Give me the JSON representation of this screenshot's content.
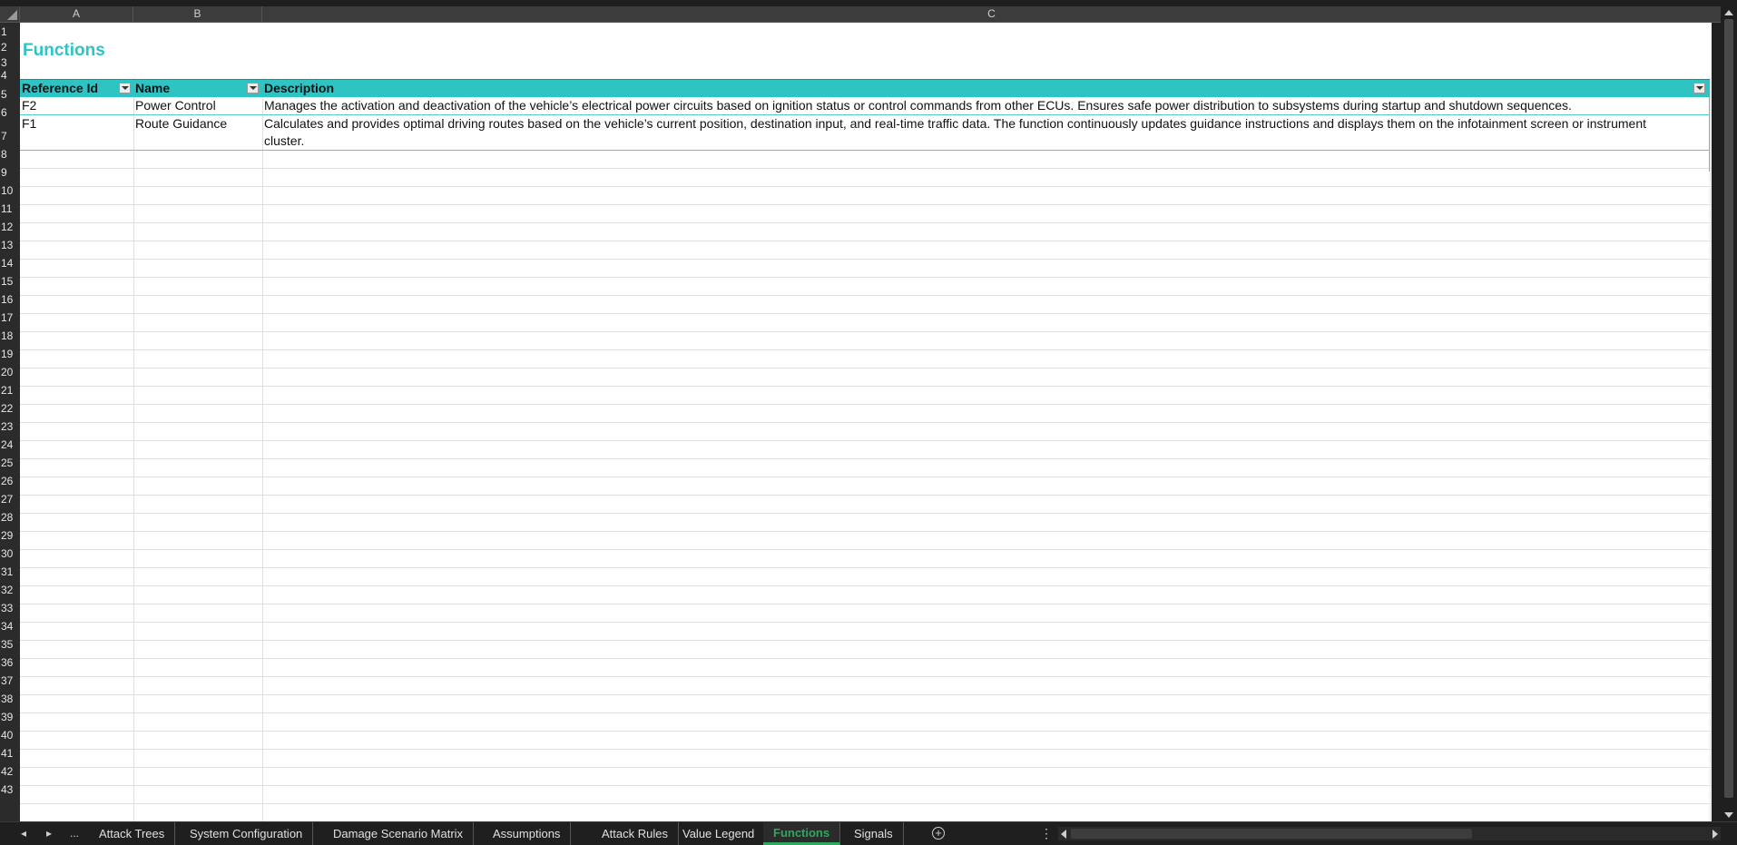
{
  "sheet": {
    "columns": [
      "A",
      "B",
      "C"
    ],
    "rows": [
      "1",
      "2",
      "3",
      "4",
      "5",
      "6",
      "7",
      "8",
      "9",
      "10",
      "11",
      "12",
      "13",
      "14",
      "15",
      "16",
      "17",
      "18",
      "19",
      "20",
      "21",
      "22",
      "23",
      "24",
      "25",
      "26",
      "27",
      "28",
      "29",
      "30",
      "31",
      "32",
      "33",
      "34",
      "35",
      "36",
      "37",
      "38",
      "39",
      "40",
      "41",
      "42",
      "43"
    ],
    "title": "Functions"
  },
  "table": {
    "headers": [
      "Reference Id",
      "Name",
      "Description"
    ],
    "rows": [
      {
        "ref": "F2",
        "name": "Power Control",
        "description": "Manages the activation and deactivation of the vehicle’s electrical power circuits based on ignition status or control commands from other ECUs. Ensures safe power distribution to subsystems during startup and shutdown sequences."
      },
      {
        "ref": "F1",
        "name": "Route Guidance",
        "description": "Calculates and provides optimal driving routes based on the vehicle’s current position, destination input, and real-time traffic data. The function continuously updates guidance instructions and displays them on the infotainment screen or instrument",
        "description_cont": "cluster."
      }
    ]
  },
  "tabs": {
    "more": "...",
    "items": [
      "Attack Trees",
      "System Configuration",
      "Damage Scenario Matrix",
      "Assumptions",
      "Attack Rules",
      "Value Legend",
      "Functions",
      "Signals"
    ],
    "active": "Functions"
  },
  "colors": {
    "accent": "#2ec4c4",
    "active_tab": "#2ea85f"
  }
}
